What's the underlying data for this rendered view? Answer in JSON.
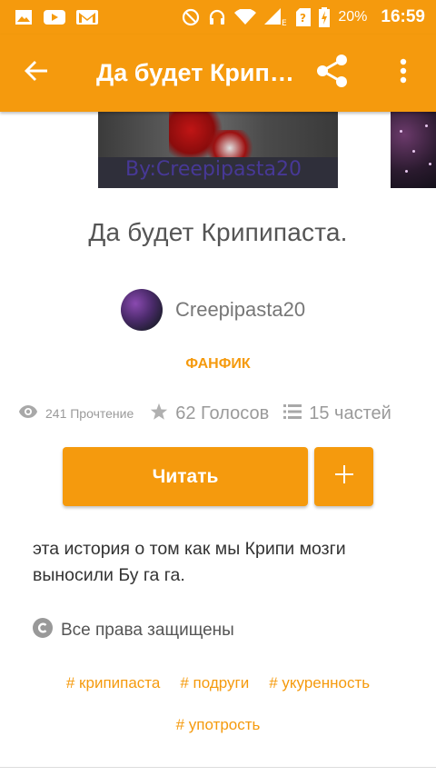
{
  "status_bar": {
    "icons": [
      "gallery-icon",
      "youtube-icon",
      "gmail-icon",
      "do-not-disturb-icon",
      "headset-icon",
      "wifi-icon",
      "signal-icon",
      "sim-unknown-icon",
      "battery-charging-icon"
    ],
    "network_type": "E",
    "battery": "20%",
    "time": "16:59"
  },
  "appbar": {
    "title": "Да будет Крипипаста.",
    "back_icon": "arrow-back-icon",
    "share_icon": "share-icon",
    "more_icon": "more-vert-icon"
  },
  "cover": {
    "credit": "By:Creepipasta20"
  },
  "story": {
    "title": "Да будет Крипипаста.",
    "author": "Creepipasta20",
    "category": "ФАНФИК",
    "reads": "241 Прочтение",
    "votes": "62 Голосов",
    "parts": "15 частей",
    "read_button": "Читать",
    "add_button": "+",
    "description": "эта история о том как мы Крипи мозги выносили Бу га га.",
    "copyright": "Все права защищены",
    "tags": [
      "# крипипаста",
      "# подруги",
      "# укуренность",
      "# употрость"
    ]
  },
  "colors": {
    "accent": "#f59a0d",
    "text_dark": "#333333",
    "text_muted": "#9a9a9a"
  }
}
